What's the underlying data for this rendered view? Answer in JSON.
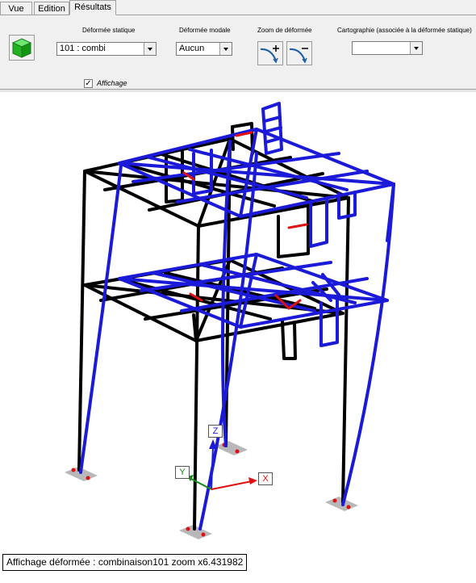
{
  "tabs": [
    {
      "label": "Vue",
      "active": false
    },
    {
      "label": "Edition",
      "active": false
    },
    {
      "label": "Résultats",
      "active": true
    }
  ],
  "toolbar": {
    "deformee_statique": {
      "label": "Déformée statique",
      "value": "101 : combi"
    },
    "deformee_modale": {
      "label": "Déformée modale",
      "value": "Aucun"
    },
    "zoom": {
      "label": "Zoom de déformée"
    },
    "cartographie": {
      "label": "Cartographie (associée à la déformée statique)",
      "value": ""
    },
    "affichage": {
      "label": "Affichage",
      "checked": true,
      "check_glyph": "✓"
    }
  },
  "axes": {
    "z": "Z",
    "y": "Y",
    "x": "X"
  },
  "status": "Affichage déformée : combinaison101   zoom x6.431982",
  "colors": {
    "undeformed": "#000000",
    "deformed": "#1a1ad8",
    "highlight": "#e01010",
    "support": "#b8b8b8"
  }
}
